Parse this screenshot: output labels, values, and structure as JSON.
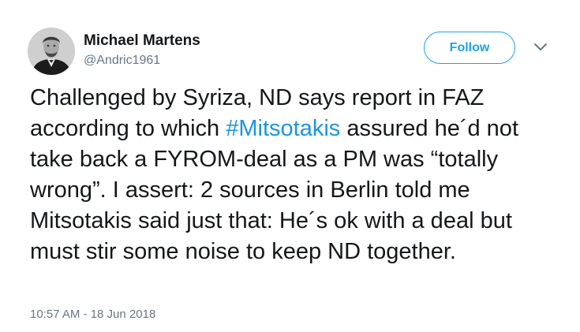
{
  "user": {
    "name": "Michael Martens",
    "handle": "@Andric1961"
  },
  "follow_label": "Follow",
  "tweet": {
    "text_before": "Challenged by Syriza, ND says report in FAZ according to which ",
    "hashtag": "#Mitsotakis",
    "text_after": " assured he´d not take back a FYROM-deal as a PM was “totally wrong”. I assert: 2 sources in Berlin told me Mitsotakis said just that: He´s ok with a deal but must stir some noise to keep ND together.",
    "timestamp": "10:57 AM - 18 Jun 2018"
  },
  "colors": {
    "accent": "#1da1f2",
    "hashtag": "#1b95e0",
    "text": "#14171a",
    "muted": "#657786"
  },
  "icons": {
    "avatar": "profile-photo",
    "menu": "chevron-down-icon"
  }
}
